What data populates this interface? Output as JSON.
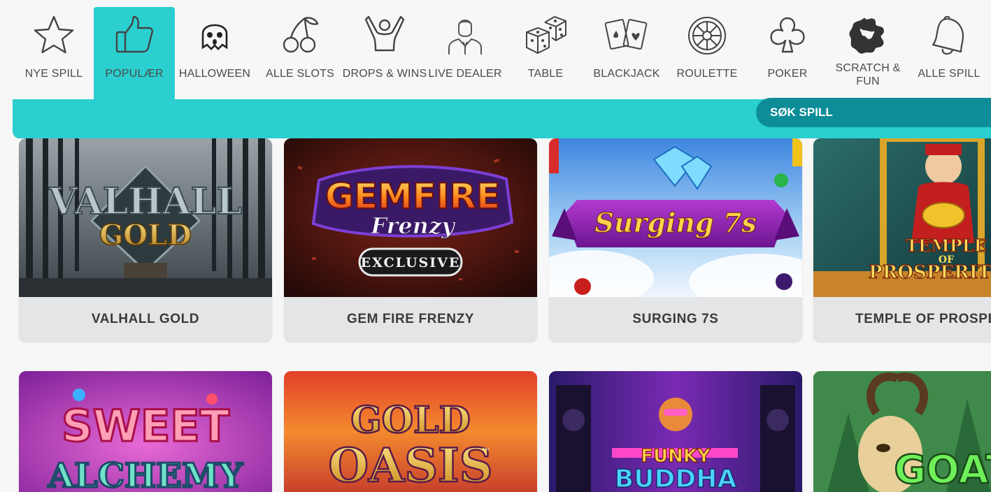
{
  "nav": {
    "items": [
      {
        "label": "NYE SPILL",
        "icon": "star-icon"
      },
      {
        "label": "POPULÆR",
        "icon": "thumbs-up-icon",
        "active": true
      },
      {
        "label": "HALLOWEEN",
        "icon": "ghost-icon"
      },
      {
        "label": "ALLE SLOTS",
        "icon": "cherries-icon"
      },
      {
        "label": "DROPS & WINS",
        "icon": "cheering-person-icon"
      },
      {
        "label": "LIVE DEALER",
        "icon": "dealer-icon"
      },
      {
        "label": "TABLE",
        "icon": "dice-icon"
      },
      {
        "label": "BLACKJACK",
        "icon": "playing-cards-icon"
      },
      {
        "label": "ROULETTE",
        "icon": "roulette-wheel-icon"
      },
      {
        "label": "POKER",
        "icon": "club-suit-icon"
      },
      {
        "label": "SCRATCH &\nFUN",
        "icon": "scratch-splat-icon"
      },
      {
        "label": "ALLE SPILL",
        "icon": "bell-icon"
      }
    ]
  },
  "search": {
    "label": "SØK SPILL"
  },
  "games_row1": [
    {
      "title": "VALHALL GOLD",
      "art_text": "VALHALL",
      "art_sub": "GOLD"
    },
    {
      "title": "GEM FIRE FRENZY",
      "art_text": "GEMFIRE",
      "art_sub": "Frenzy",
      "badge": "EXCLUSIVE"
    },
    {
      "title": "SURGING 7S",
      "art_text": "Surging 7s"
    },
    {
      "title": "TEMPLE OF PROSPERITY",
      "art_text": "TEMPLE",
      "art_sub": "PROSPERITY",
      "art_of": "OF"
    }
  ],
  "games_row2": [
    {
      "art_text": "SWEET",
      "art_sub": "ALCHEMY"
    },
    {
      "art_text": "GOLD",
      "art_sub": "OASIS",
      "art_tm": "™"
    },
    {
      "art_text": "FUNKY",
      "art_sub": "BUDDHA"
    },
    {
      "art_text": "GOAT"
    }
  ],
  "colors": {
    "accent_teal": "#2bcfd0",
    "search_teal": "#0d8d97",
    "card_bg": "#e4e5e7",
    "page_bg": "#f7f7f8"
  }
}
